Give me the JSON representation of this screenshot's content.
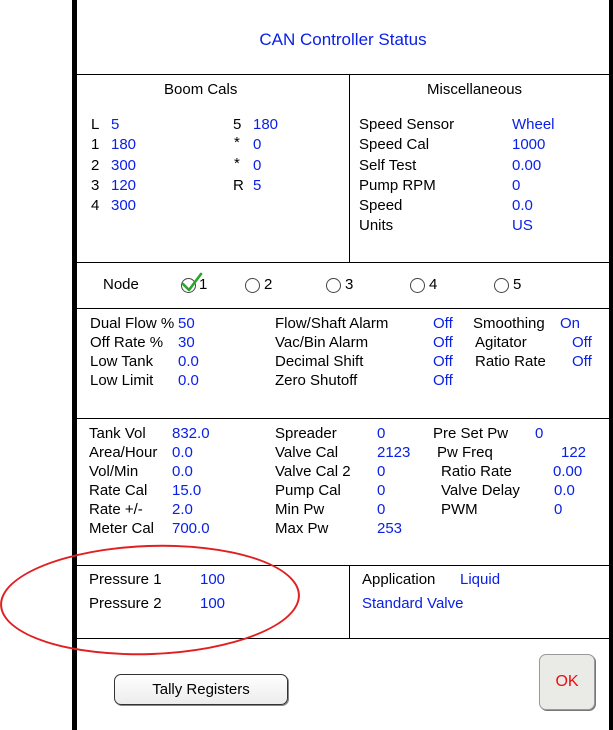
{
  "title": "CAN Controller Status",
  "boom_cals": {
    "header": "Boom Cals",
    "left": [
      {
        "label": "L",
        "value": "5"
      },
      {
        "label": "1",
        "value": "180"
      },
      {
        "label": "2",
        "value": "300"
      },
      {
        "label": "3",
        "value": "120"
      },
      {
        "label": "4",
        "value": "300"
      }
    ],
    "right": [
      {
        "label": "5",
        "value": "180"
      },
      {
        "label": "*",
        "value": "0"
      },
      {
        "label": "*",
        "value": "0"
      },
      {
        "label": "R",
        "value": "5"
      }
    ]
  },
  "misc": {
    "header": "Miscellaneous",
    "rows": [
      {
        "label": "Speed Sensor",
        "value": "Wheel"
      },
      {
        "label": "Speed Cal",
        "value": "1000"
      },
      {
        "label": "Self Test",
        "value": "0.00"
      },
      {
        "label": "Pump RPM",
        "value": "0"
      },
      {
        "label": "Speed",
        "value": "0.0"
      },
      {
        "label": "Units",
        "value": "US"
      }
    ]
  },
  "node": {
    "label": "Node",
    "options": [
      "1",
      "2",
      "3",
      "4",
      "5"
    ],
    "selected": "1"
  },
  "settings": {
    "col1": [
      {
        "label": "Dual Flow %",
        "value": "50"
      },
      {
        "label": "Off Rate %",
        "value": "30"
      },
      {
        "label": "Low Tank",
        "value": "0.0"
      },
      {
        "label": "Low Limit",
        "value": "0.0"
      }
    ],
    "col2": [
      {
        "label": "Flow/Shaft Alarm",
        "value": "Off"
      },
      {
        "label": "Vac/Bin Alarm",
        "value": "Off"
      },
      {
        "label": "Decimal Shift",
        "value": "Off"
      },
      {
        "label": "Zero Shutoff",
        "value": "Off"
      }
    ],
    "col3": [
      {
        "label": "Smoothing",
        "value": "On"
      },
      {
        "label": "Agitator",
        "value": "Off"
      },
      {
        "label": "Ratio Rate",
        "value": "Off"
      }
    ]
  },
  "values": {
    "col1": [
      {
        "label": "Tank Vol",
        "value": "832.0"
      },
      {
        "label": "Area/Hour",
        "value": "0.0"
      },
      {
        "label": "Vol/Min",
        "value": "0.0"
      },
      {
        "label": "Rate Cal",
        "value": "15.0"
      },
      {
        "label": "Rate +/-",
        "value": "2.0"
      },
      {
        "label": "Meter Cal",
        "value": "700.0"
      }
    ],
    "col2": [
      {
        "label": "Spreader",
        "value": "0"
      },
      {
        "label": "Valve Cal",
        "value": "2123"
      },
      {
        "label": "Valve Cal 2",
        "value": "0"
      },
      {
        "label": "Pump Cal",
        "value": "0"
      },
      {
        "label": "Min Pw",
        "value": "0"
      },
      {
        "label": "Max Pw",
        "value": "253"
      }
    ],
    "col3": [
      {
        "label": "Pre Set Pw",
        "value": "0"
      },
      {
        "label": "Pw Freq",
        "value": "122"
      },
      {
        "label": "Ratio Rate",
        "value": "0.00"
      },
      {
        "label": "Valve Delay",
        "value": "0.0"
      },
      {
        "label": "PWM",
        "value": "0"
      }
    ]
  },
  "pressure": [
    {
      "label": "Pressure 1",
      "value": "100"
    },
    {
      "label": "Pressure 2",
      "value": "100"
    }
  ],
  "application": {
    "label": "Application",
    "value": "Liquid",
    "valve": "Standard Valve"
  },
  "buttons": {
    "tally": "Tally Registers",
    "ok": "OK"
  },
  "colors": {
    "value_blue": "#0a20e6",
    "ok_red": "#e81010",
    "highlight_ellipse": "#e02020",
    "check_green": "#2aa52a"
  }
}
